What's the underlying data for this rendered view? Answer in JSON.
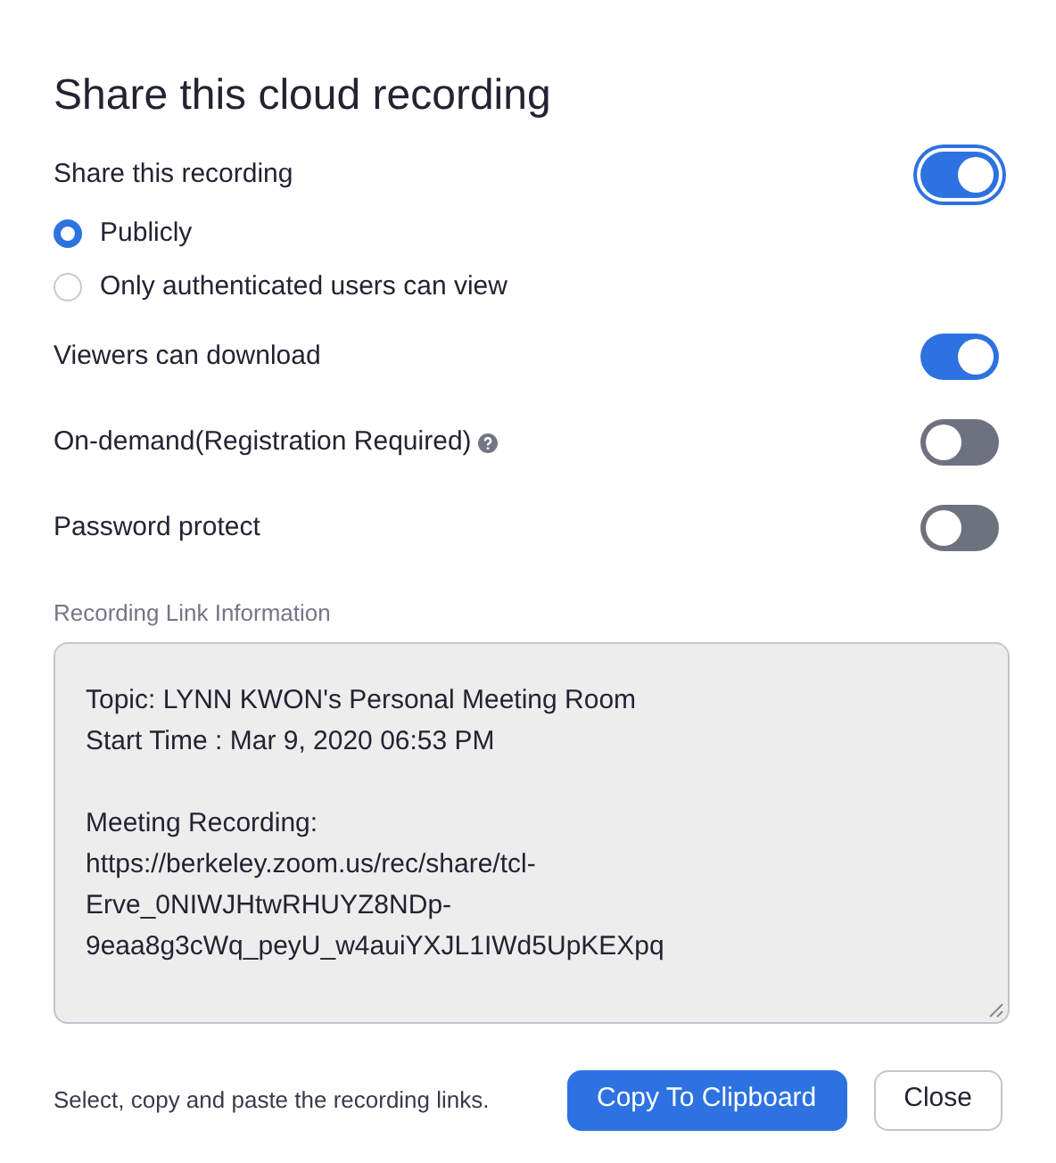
{
  "dialog": {
    "title": "Share this cloud recording"
  },
  "settings": [
    {
      "kind": "toggle",
      "label": "Share this recording",
      "on": true,
      "focused": true,
      "help": false
    },
    {
      "kind": "radio",
      "label": "Publicly",
      "selected": true
    },
    {
      "kind": "radio",
      "label": "Only authenticated users can view",
      "selected": false
    },
    {
      "kind": "toggle",
      "label": "Viewers can download",
      "on": true,
      "focused": false,
      "help": false
    },
    {
      "kind": "toggle",
      "label": "On-demand(Registration Required)",
      "on": false,
      "focused": false,
      "help": true
    },
    {
      "kind": "toggle",
      "label": "Password protect",
      "on": false,
      "focused": false,
      "help": false
    }
  ],
  "link_info": {
    "label": "Recording Link Information",
    "paragraphs": [
      {
        "lines": [
          "Topic: LYNN KWON's Personal Meeting Room",
          "Start Time : Mar 9, 2020 06:53 PM"
        ]
      },
      {
        "lines": [
          "Meeting Recording:",
          "https://berkeley.zoom.us/rec/share/tcl-",
          "Erve_0NIWJHtwRHUYZ8NDp-",
          "9eaa8g3cWq_peyU_w4auiYXJL1IWd5UpKEXpq"
        ]
      }
    ]
  },
  "footer": {
    "hint": "Select, copy and paste the recording links.",
    "buttons": [
      {
        "kind": "primary",
        "label": "Copy To Clipboard"
      },
      {
        "kind": "secondary",
        "label": "Close"
      }
    ]
  }
}
